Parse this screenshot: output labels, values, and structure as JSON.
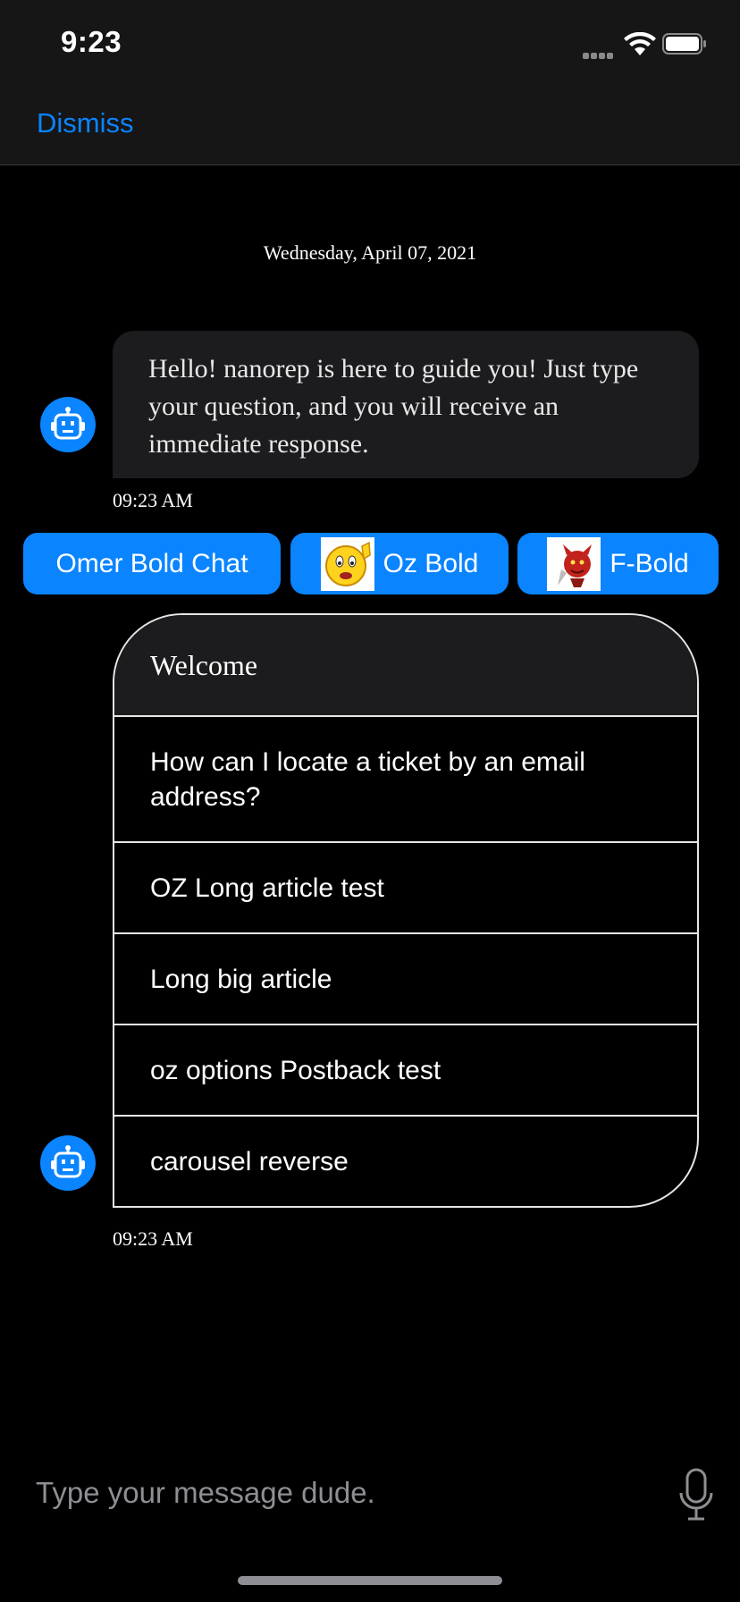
{
  "status_bar": {
    "time": "9:23"
  },
  "nav": {
    "dismiss_label": "Dismiss"
  },
  "chat": {
    "date_header": "Wednesday, April 07, 2021",
    "messages": [
      {
        "sender": "bot",
        "text": "Hello! nanorep is here to guide you! Just type your question, and you will receive an immediate response.",
        "time": "09:23 AM"
      },
      {
        "sender": "bot",
        "time": "09:23 AM"
      }
    ],
    "quick_replies": [
      {
        "label": "Omer Bold Chat",
        "icon": ""
      },
      {
        "label": "Oz Bold",
        "icon": "waving-smiley-icon"
      },
      {
        "label": "F-Bold",
        "icon": "red-devil-icon"
      }
    ],
    "carousel": {
      "title": "Welcome",
      "options": [
        "How can I locate a ticket by an email address?",
        "OZ Long article test",
        "Long big article",
        "oz options Postback test",
        "carousel reverse"
      ]
    }
  },
  "input": {
    "placeholder": "Type your message dude."
  },
  "colors": {
    "accent": "#0a84ff",
    "background": "#000000",
    "bar": "#161616",
    "bubble": "#1c1c1e"
  }
}
